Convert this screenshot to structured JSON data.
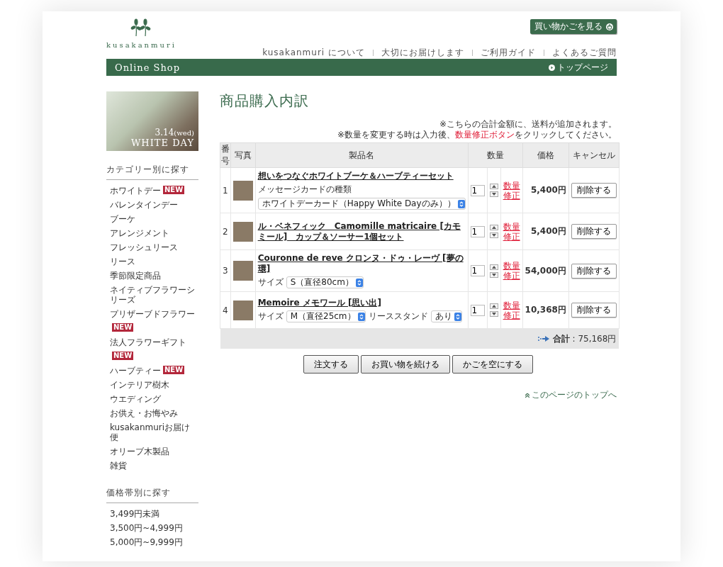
{
  "header": {
    "logo": "kusakanmuri",
    "cart_button": "買い物かごを見る",
    "nav": [
      "kusakanmuri について",
      "大切にお届けします",
      "ご利用ガイド",
      "よくあるご質問"
    ],
    "bar_title": "Online Shop",
    "top_link": "トップページ"
  },
  "sidebar": {
    "banner": {
      "date": "3.14",
      "weekday": "(wed)",
      "title": "WHITE DAY"
    },
    "category_heading": "カテゴリー別に探す",
    "categories": [
      {
        "label": "ホワイトデー",
        "badge": "NEW"
      },
      {
        "label": "バレンタインデー"
      },
      {
        "label": "ブーケ"
      },
      {
        "label": "アレンジメント"
      },
      {
        "label": "フレッシュリース"
      },
      {
        "label": "リース"
      },
      {
        "label": "季節限定商品"
      },
      {
        "label": "ネイティブフラワーシリーズ"
      },
      {
        "label": "プリザーブドフラワー",
        "badge": "NEW"
      },
      {
        "label": "法人フラワーギフト",
        "badge": "NEW"
      },
      {
        "label": "ハーブティー",
        "badge": "NEW"
      },
      {
        "label": "インテリア樹木"
      },
      {
        "label": "ウエディング"
      },
      {
        "label": "お供え・お悔やみ"
      },
      {
        "label": "kusakanmuriお届け便"
      },
      {
        "label": "オリーブ木製品"
      },
      {
        "label": "雑貨"
      }
    ],
    "price_heading": "価格帯別に探す",
    "prices": [
      "3,499円未満",
      "3,500円~4,999円",
      "5,000円~9,999円"
    ]
  },
  "cart": {
    "title": "商品購入内訳",
    "note_1": "※こちらの合計金額に、送料が追加されます。",
    "note_2_before": "※数量を変更する時は入力後、",
    "note_2_highlight": "数量修正ボタン",
    "note_2_after": "をクリックしてください。",
    "columns": [
      "番号",
      "写真",
      "製品名",
      "数量",
      "価格",
      "キャンセル"
    ],
    "rows": [
      {
        "number": "1",
        "name": "想いをつなぐホワイトブーケ＆ハーブティーセット",
        "options": [
          {
            "label": "メッセージカードの種類",
            "value": "ホワイトデーカード（Happy White Dayのみ））"
          }
        ],
        "quantity": "1",
        "update": "数量修正",
        "price": "5,400円",
        "delete": "削除する"
      },
      {
        "number": "2",
        "name": "ル・ベネフィック　Camomille matricaire [カモミール]　カップ＆ソーサー1個セット",
        "options": [],
        "quantity": "1",
        "update": "数量修正",
        "price": "5,400円",
        "delete": "削除する"
      },
      {
        "number": "3",
        "name": "Couronne de reve クロンヌ・ドゥ・レーヴ [夢の環]",
        "options": [
          {
            "label": "サイズ",
            "value": "S（直径80cm）"
          }
        ],
        "quantity": "1",
        "update": "数量修正",
        "price": "54,000円",
        "delete": "削除する"
      },
      {
        "number": "4",
        "name": "Memoire メモワール [思い出]",
        "options": [
          {
            "label": "サイズ",
            "value": "M（直径25cm）"
          },
          {
            "label": "リーススタンド",
            "value": "あり"
          }
        ],
        "quantity": "1",
        "update": "数量修正",
        "price": "10,368円",
        "delete": "削除する"
      }
    ],
    "total": "**合計** : 75,168円",
    "buttons": [
      "注文する",
      "お買い物を続ける",
      "かごを空にする"
    ],
    "page_top": "このページのトップへ"
  }
}
